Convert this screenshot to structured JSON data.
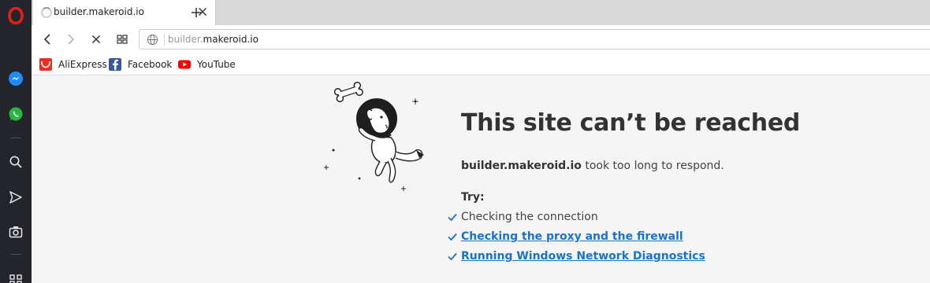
{
  "tab": {
    "title": "builder.makeroid.io"
  },
  "address_bar": {
    "url_prefix": "builder.",
    "url_host": "makeroid.io"
  },
  "bookmarks": [
    {
      "label": "AliExpress",
      "icon": "aliexpress-icon",
      "color": "#e43225"
    },
    {
      "label": "Facebook",
      "icon": "facebook-icon",
      "color": "#3b5998"
    },
    {
      "label": "YouTube",
      "icon": "youtube-icon",
      "color": "#ff0000"
    }
  ],
  "sidebar": {
    "items": [
      "opera-logo-icon",
      "messenger-icon",
      "whatsapp-icon",
      "search-icon",
      "send-icon",
      "camera-icon",
      "grid-icon"
    ]
  },
  "error": {
    "title": "This site can’t be reached",
    "host": "builder.makeroid.io",
    "message": " took too long to respond.",
    "try_label": "Try:",
    "suggestions": [
      {
        "text": "Checking the connection",
        "link": false
      },
      {
        "text": "Checking the proxy and the firewall",
        "link": true
      },
      {
        "text": "Running Windows Network Diagnostics",
        "link": true
      }
    ]
  },
  "colors": {
    "link": "#1a73c9",
    "check": "#1a73c9",
    "opera_red": "#e0201c",
    "sidebar_bg": "#23252b"
  }
}
